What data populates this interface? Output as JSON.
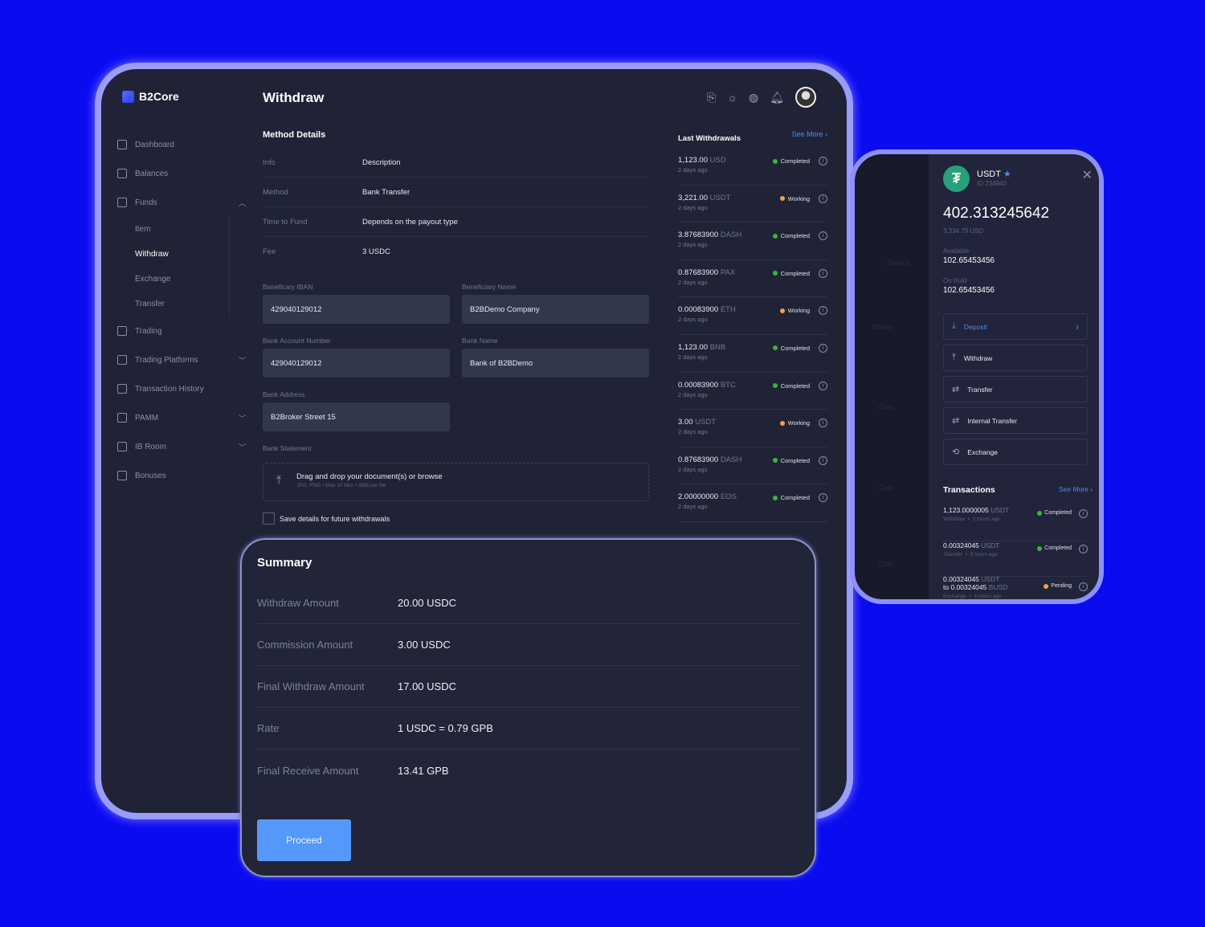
{
  "app": {
    "brand": "B2Core",
    "page_title": "Withdraw"
  },
  "sidebar": {
    "items": [
      {
        "label": "Dashboard",
        "icon": "dashboard-icon"
      },
      {
        "label": "Balances",
        "icon": "wallet-icon"
      },
      {
        "label": "Funds",
        "icon": "transfer-arrows-icon",
        "expanded": true,
        "children": [
          "Item",
          "Withdraw",
          "Exchange",
          "Transfer"
        ],
        "active_child": "Withdraw"
      },
      {
        "label": "Trading",
        "icon": "chart-line-icon"
      },
      {
        "label": "Trading Platforms",
        "icon": "layers-icon",
        "collapsed": true
      },
      {
        "label": "Transaction History",
        "icon": "history-icon"
      },
      {
        "label": "PAMM",
        "icon": "pamm-icon",
        "collapsed": true
      },
      {
        "label": "IB Room",
        "icon": "users-icon",
        "collapsed": true
      },
      {
        "label": "Bonuses",
        "icon": "gift-icon"
      }
    ]
  },
  "header_icons": [
    "download-doc-icon",
    "sun-icon",
    "globe-icon",
    "bell-icon",
    "avatar"
  ],
  "method": {
    "title": "Method Details",
    "rows": [
      {
        "k": "Info",
        "v": "Description"
      },
      {
        "k": "Method",
        "v": "Bank Transfer"
      },
      {
        "k": "Time to Fund",
        "v": "Depends on the payout type"
      },
      {
        "k": "Fee",
        "v": "3 USDC"
      }
    ],
    "fields": {
      "iban_label": "Baneficary IBAN",
      "iban": "429040129012",
      "ben_label": "Beneficiary Name",
      "ben": "B2BDemo Company",
      "acct_label": "Bank Account Number",
      "acct": "429040129012",
      "bank_label": "Bank Name",
      "bank": "Bank of B2BDemo",
      "addr_label": "Bank Address",
      "addr": "B2Broker Street 15",
      "stmt_label": "Bank Statement"
    },
    "drop_title": "Drag and drop your document(s) or browse",
    "drop_hint": "JPG, PNG • Max 10 files • 3MB per file",
    "save_label": "Save details for future withdrawals"
  },
  "last_withdrawals": {
    "title": "Last Withdrawals",
    "see_more": "See More",
    "items": [
      {
        "amount": "1,123.00",
        "cur": "USD",
        "ago": "2 days ago",
        "status": "Completed"
      },
      {
        "amount": "3,221.00",
        "cur": "USDT",
        "ago": "2 days ago",
        "status": "Working"
      },
      {
        "amount": "3.87683900",
        "cur": "DASH",
        "ago": "2 days ago",
        "status": "Completed"
      },
      {
        "amount": "0.87683900",
        "cur": "PAX",
        "ago": "2 days ago",
        "status": "Completed"
      },
      {
        "amount": "0.00083900",
        "cur": "ETH",
        "ago": "2 days ago",
        "status": "Working"
      },
      {
        "amount": "1,123.00",
        "cur": "BNB",
        "ago": "2 days ago",
        "status": "Completed"
      },
      {
        "amount": "0.00083900",
        "cur": "BTC",
        "ago": "2 days ago",
        "status": "Completed"
      },
      {
        "amount": "3.00",
        "cur": "USDT",
        "ago": "2 days ago",
        "status": "Working"
      },
      {
        "amount": "0.87683900",
        "cur": "DASH",
        "ago": "2 days ago",
        "status": "Completed"
      },
      {
        "amount": "2.00000000",
        "cur": "EOS",
        "ago": "2 days ago",
        "status": "Completed"
      }
    ]
  },
  "status_colors": {
    "Completed": "#3cb53c",
    "Working": "#f5a04a",
    "Pending": "#f5a04a"
  },
  "drawer": {
    "coin": "USDT",
    "coin_id": "ID 234940",
    "balance": "402.313245642",
    "balance_usd": "3,334.79 USD",
    "available_label": "Available",
    "available": "102.65453456",
    "hold_label": "On Hold",
    "hold": "102.65453456",
    "actions": [
      {
        "label": "Deposit",
        "icon": "download-icon"
      },
      {
        "label": "Withdraw",
        "icon": "upload-icon"
      },
      {
        "label": "Transfer",
        "icon": "transfer-icon"
      },
      {
        "label": "Internal Transfer",
        "icon": "transfer-icon"
      },
      {
        "label": "Exchange",
        "icon": "exchange-icon"
      }
    ],
    "tx_title": "Transactions",
    "see_more": "See More",
    "tx": [
      {
        "amount": "1,123.0000005",
        "cur": "USDT",
        "meta": "Withdraw  •  2 hours ago",
        "status": "Completed"
      },
      {
        "amount": "0.00324045",
        "cur": "USDT",
        "meta": "Transfer  •  3 hours ago",
        "status": "Completed"
      },
      {
        "amount": "0.00324045",
        "cur": "USDT",
        "to": "to 0.00324045",
        "to_cur": "BUSD",
        "meta": "Exchange  •  4 hours ago",
        "status": "Pending"
      }
    ],
    "background_labels": [
      "Search",
      "Stable",
      "Coin",
      "Coin",
      "Coin"
    ]
  },
  "summary": {
    "title": "Summary",
    "rows": [
      {
        "k": "Withdraw Amount",
        "v": "20.00 USDC"
      },
      {
        "k": "Commission Amount",
        "v": "3.00 USDC"
      },
      {
        "k": "Final Withdraw Amount",
        "v": "17.00 USDC"
      },
      {
        "k": "Rate",
        "v": "1 USDC = 0.79 GPB"
      },
      {
        "k": "Final Receive Amount",
        "v": "13.41 GPB"
      }
    ],
    "proceed": "Proceed"
  },
  "colors": {
    "background": "#0b0bf0",
    "panel": "#202335",
    "accent": "#5598fb",
    "tether": "#26a17b"
  }
}
